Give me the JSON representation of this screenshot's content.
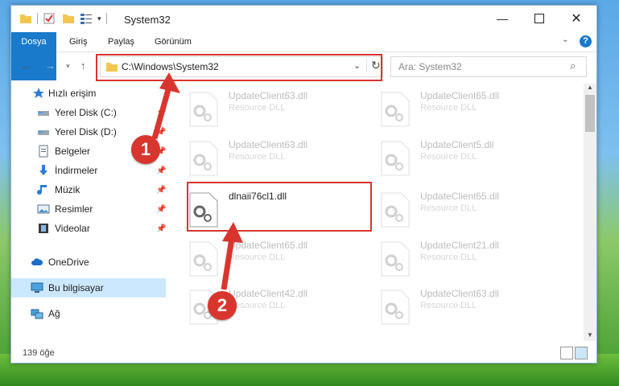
{
  "window": {
    "title": "System32"
  },
  "ribbon": {
    "tabs": [
      "Dosya",
      "Giriş",
      "Paylaş",
      "Görünüm"
    ]
  },
  "address": {
    "path": "C:\\Windows\\System32"
  },
  "search": {
    "placeholder": "Ara: System32"
  },
  "sidebar": {
    "items": [
      {
        "label": "Hızlı erişim",
        "icon": "star-icon",
        "pinned": false
      },
      {
        "label": "Yerel Disk (C:)",
        "icon": "disk-icon",
        "pinned": true
      },
      {
        "label": "Yerel Disk (D:)",
        "icon": "disk-icon",
        "pinned": true
      },
      {
        "label": "Belgeler",
        "icon": "document-icon",
        "pinned": true
      },
      {
        "label": "İndirmeler",
        "icon": "download-icon",
        "pinned": true
      },
      {
        "label": "Müzik",
        "icon": "music-icon",
        "pinned": true
      },
      {
        "label": "Resimler",
        "icon": "pictures-icon",
        "pinned": true
      },
      {
        "label": "Videolar",
        "icon": "video-icon",
        "pinned": true
      },
      {
        "label": "OneDrive",
        "icon": "cloud-icon",
        "pinned": false
      },
      {
        "label": "Bu bilgisayar",
        "icon": "computer-icon",
        "pinned": false,
        "selected": true
      },
      {
        "label": "Ağ",
        "icon": "network-icon",
        "pinned": false
      }
    ]
  },
  "files": [
    {
      "name": "UpdateClient63.dll",
      "type": "Resource DLL",
      "faded": true
    },
    {
      "name": "UpdateClient65.dll",
      "type": "Resource DLL",
      "faded": true
    },
    {
      "name": "UpdateClient63.dll",
      "type": "Resource DLL",
      "faded": true
    },
    {
      "name": "UpdateClient5.dll",
      "type": "Resource DLL",
      "faded": true
    },
    {
      "name": "dlnaii76cl1.dll",
      "type": "",
      "faded": false,
      "highlighted": true
    },
    {
      "name": "UpdateClient65.dll",
      "type": "Resource DLL",
      "faded": true
    },
    {
      "name": "UpdateClient65.dll",
      "type": "Resource DLL",
      "faded": true
    },
    {
      "name": "UpdateClient21.dll",
      "type": "Resource DLL",
      "faded": true
    },
    {
      "name": "UpdateClient42.dll",
      "type": "Resource DLL",
      "faded": true
    },
    {
      "name": "UpdateClient63.dll",
      "type": "Resource DLL",
      "faded": true
    }
  ],
  "status": {
    "count": "139 öğe"
  },
  "annotations": {
    "step1": "1",
    "step2": "2"
  },
  "colors": {
    "accent": "#1979ca",
    "highlight": "#d9352f",
    "selected": "#cce8ff"
  }
}
